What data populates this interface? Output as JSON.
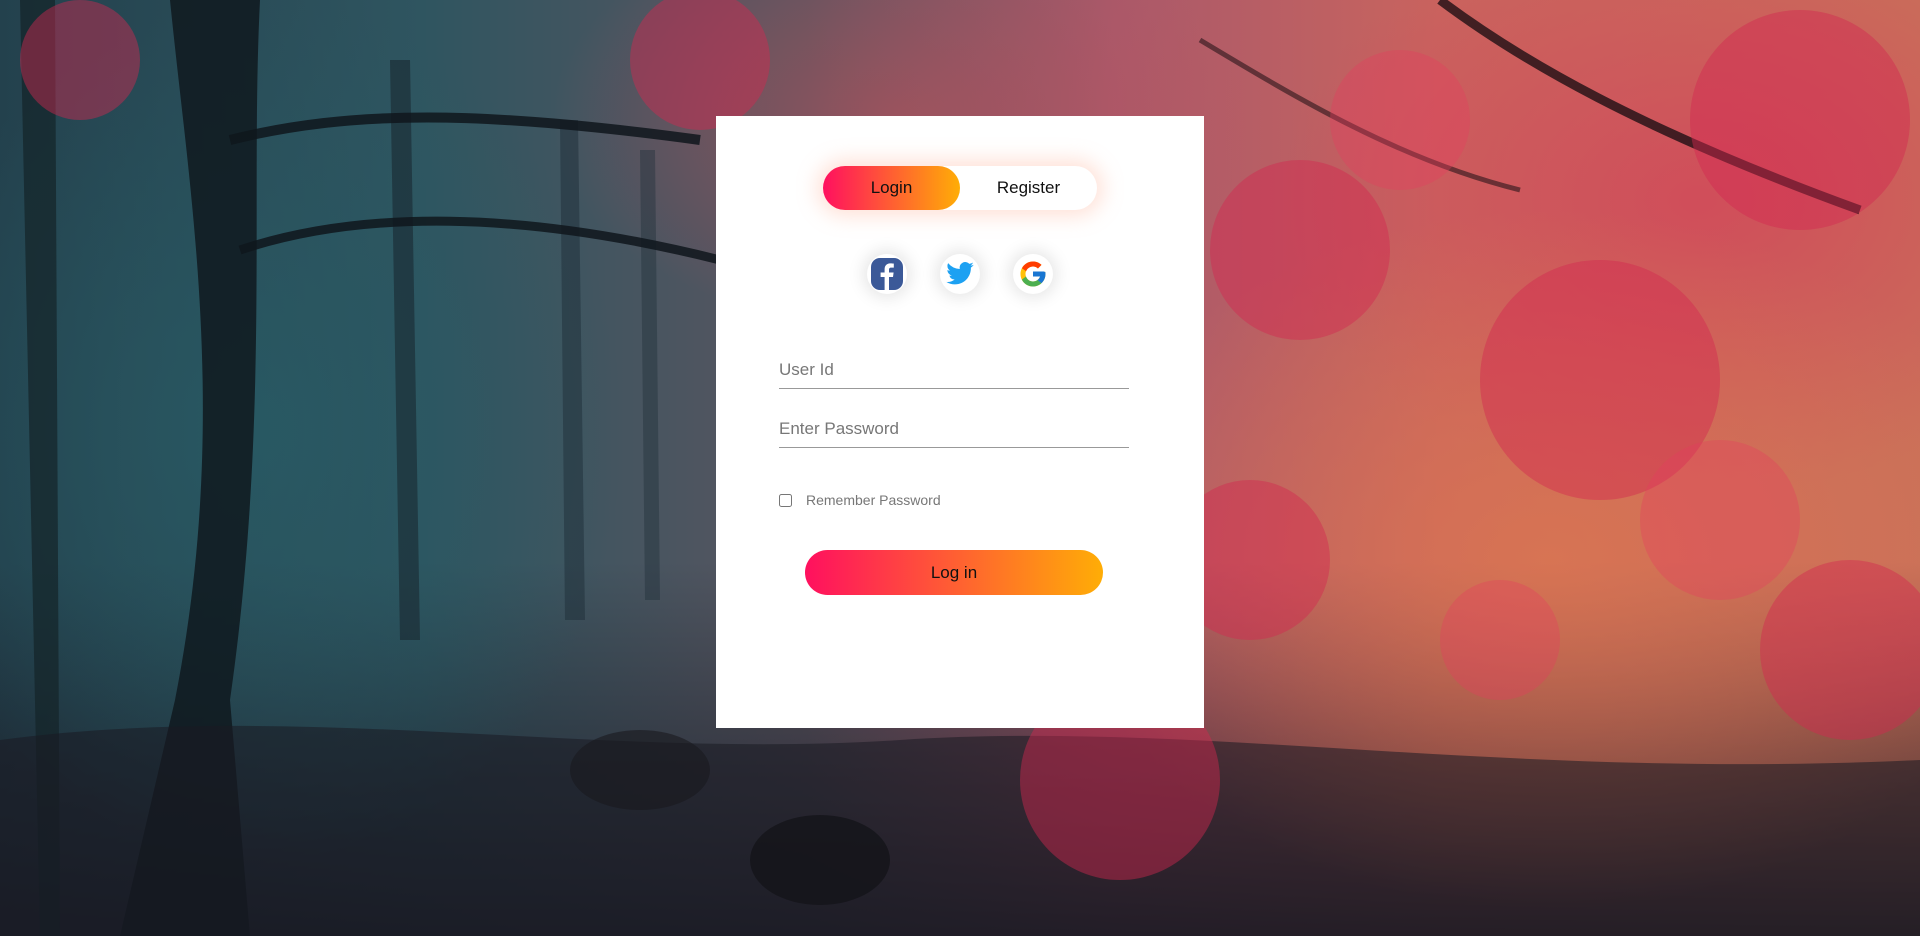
{
  "tabs": {
    "login_label": "Login",
    "register_label": "Register",
    "active": "login"
  },
  "social": [
    {
      "icon": "facebook-icon",
      "color": "#3b5998"
    },
    {
      "icon": "twitter-icon",
      "color": "#1da1f2"
    },
    {
      "icon": "google-icon",
      "color": "#4285f4"
    }
  ],
  "form": {
    "user_id_placeholder": "User Id",
    "user_id_value": "",
    "password_placeholder": "Enter Password",
    "password_value": "",
    "remember_label": "Remember Password",
    "remember_checked": false,
    "submit_label": "Log in"
  },
  "colors": {
    "gradient_start": "#ff105f",
    "gradient_end": "#ffad06",
    "card_background": "#ffffff"
  }
}
